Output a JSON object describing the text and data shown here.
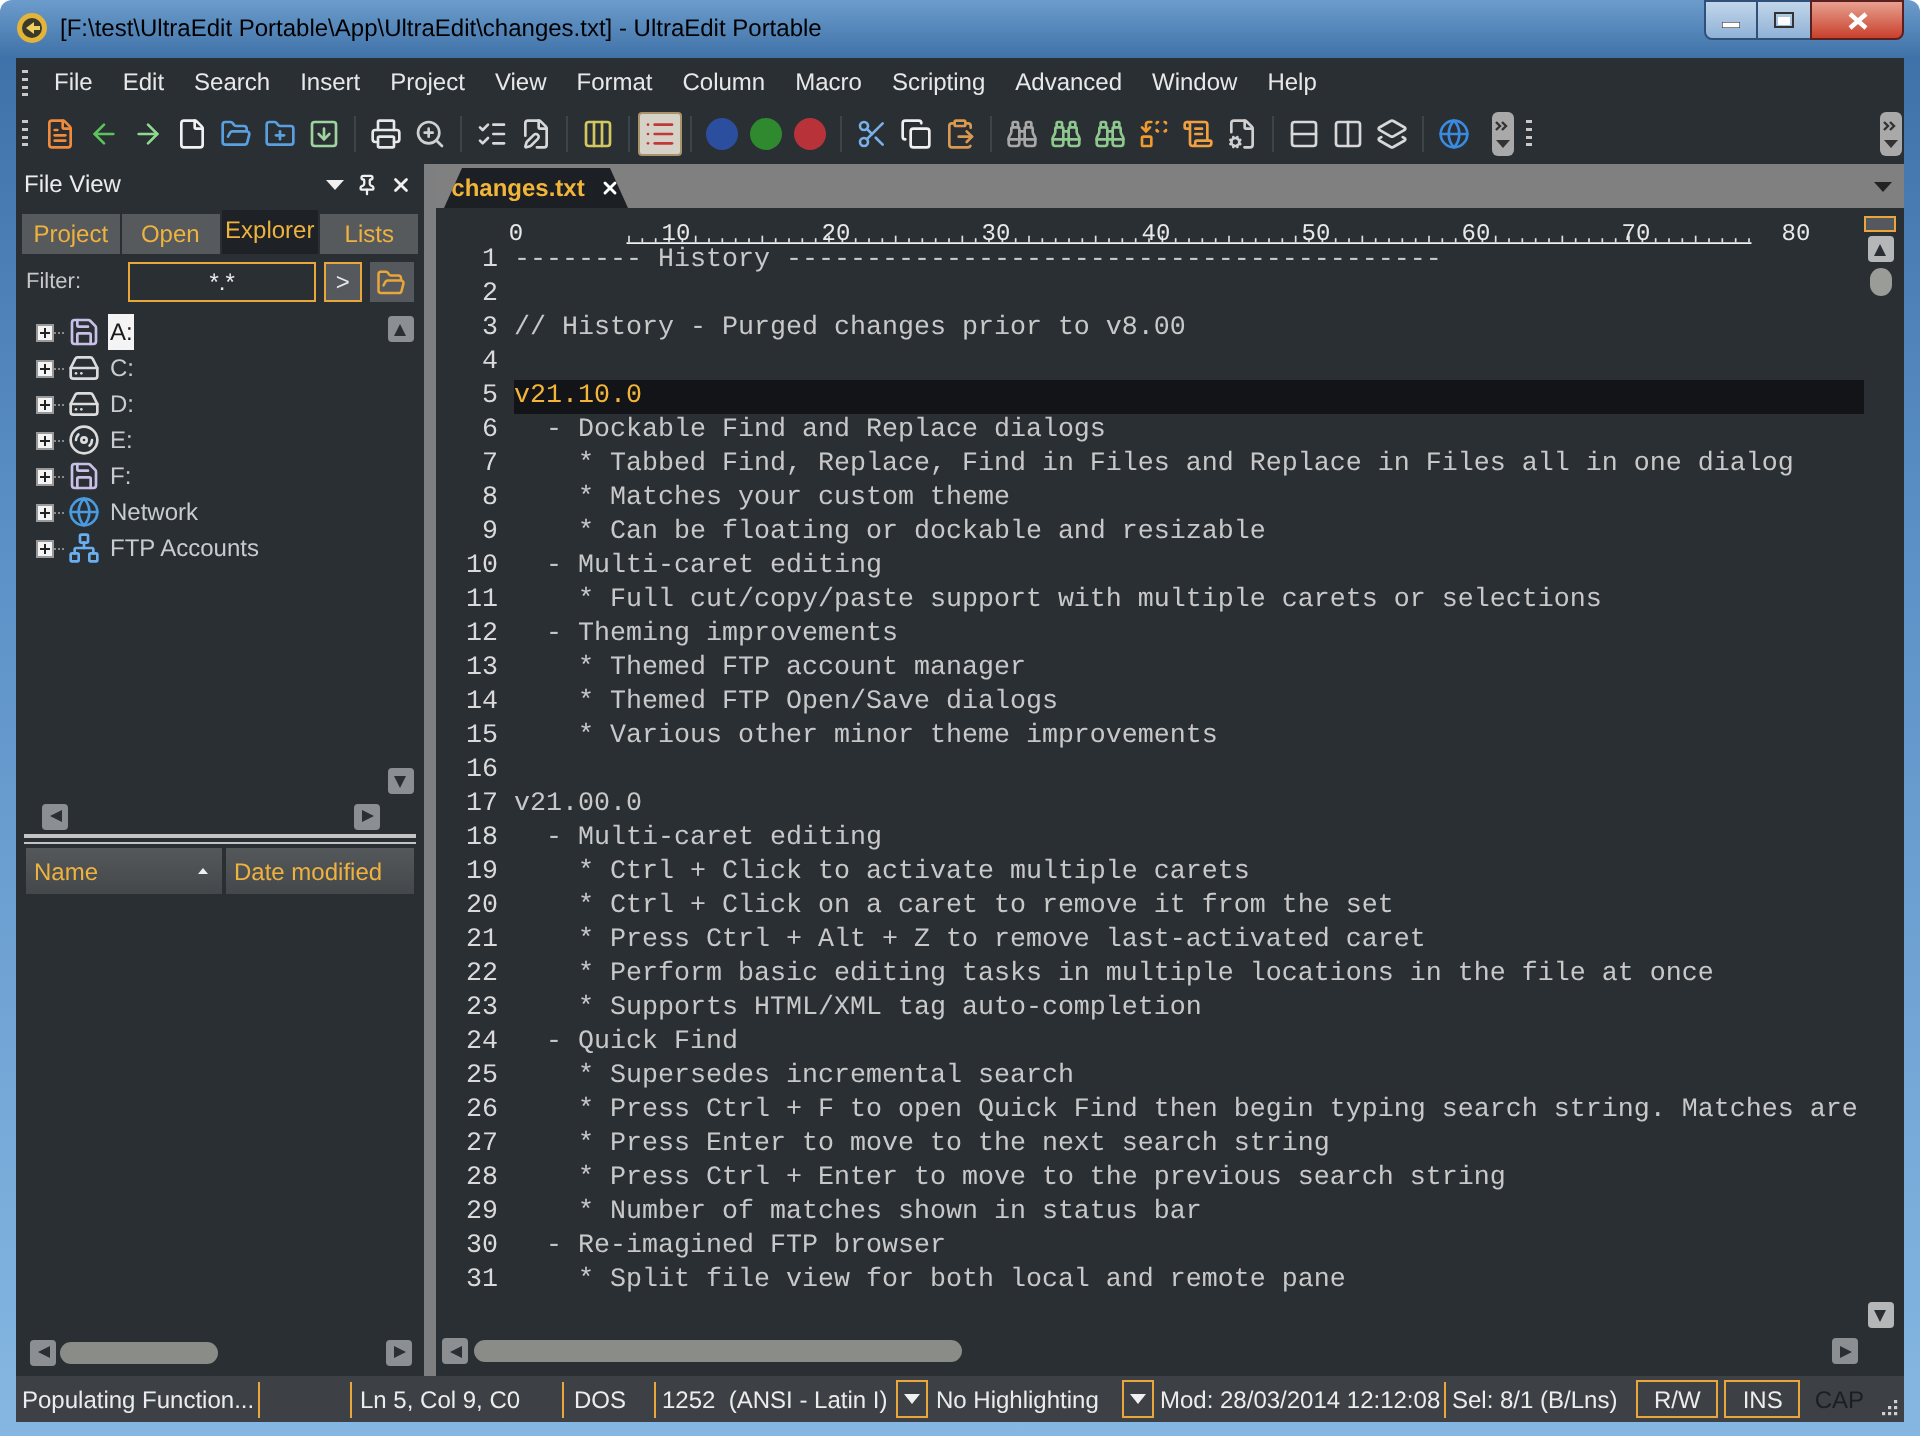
{
  "window": {
    "title": "[F:\\test\\UltraEdit Portable\\App\\UltraEdit\\changes.txt] - UltraEdit Portable"
  },
  "menu": [
    "File",
    "Edit",
    "Search",
    "Insert",
    "Project",
    "View",
    "Format",
    "Column",
    "Macro",
    "Scripting",
    "Advanced",
    "Window",
    "Help"
  ],
  "toolbar": {
    "buttons": [
      {
        "kind": "template",
        "pressed": false
      },
      {
        "kind": "back",
        "pressed": false
      },
      {
        "kind": "forward",
        "pressed": false
      },
      {
        "kind": "new",
        "pressed": false
      },
      {
        "kind": "open",
        "pressed": false
      },
      {
        "kind": "newfolder",
        "pressed": false
      },
      {
        "kind": "save",
        "pressed": false
      },
      {
        "kind": "separator"
      },
      {
        "kind": "print",
        "pressed": false
      },
      {
        "kind": "preview",
        "pressed": false
      },
      {
        "kind": "separator"
      },
      {
        "kind": "checklist",
        "pressed": false
      },
      {
        "kind": "edit",
        "pressed": false
      },
      {
        "kind": "separator"
      },
      {
        "kind": "columns",
        "pressed": false
      },
      {
        "kind": "separator"
      },
      {
        "kind": "list",
        "pressed": true
      },
      {
        "kind": "separator"
      },
      {
        "kind": "badge",
        "color": "#2b4f9e",
        "pressed": false
      },
      {
        "kind": "badge",
        "color": "#2f8a2f",
        "pressed": false
      },
      {
        "kind": "badge",
        "color": "#b8323a",
        "pressed": false
      },
      {
        "kind": "separator"
      },
      {
        "kind": "cut",
        "pressed": false
      },
      {
        "kind": "copy",
        "pressed": false
      },
      {
        "kind": "paste",
        "pressed": false
      },
      {
        "kind": "separator"
      },
      {
        "kind": "find",
        "pressed": false
      },
      {
        "kind": "findprev",
        "pressed": false
      },
      {
        "kind": "findnext",
        "pressed": false
      },
      {
        "kind": "replace",
        "pressed": false
      },
      {
        "kind": "lines",
        "pressed": false
      },
      {
        "kind": "docgear",
        "pressed": false
      },
      {
        "kind": "separator"
      },
      {
        "kind": "tileh",
        "pressed": false
      },
      {
        "kind": "tilev",
        "pressed": false
      },
      {
        "kind": "cascade",
        "pressed": false
      },
      {
        "kind": "separator"
      },
      {
        "kind": "web",
        "pressed": false
      }
    ]
  },
  "file_view": {
    "title": "File View",
    "tabs": [
      {
        "label": "Project",
        "selected": false
      },
      {
        "label": "Open",
        "selected": false
      },
      {
        "label": "Explorer",
        "selected": true
      },
      {
        "label": "Lists",
        "selected": false
      }
    ],
    "filter": {
      "label": "Filter:",
      "value": "*.*",
      "go": ">"
    },
    "tree": [
      {
        "label": "A:",
        "kind": "floppy",
        "selected": true,
        "expanded": false
      },
      {
        "label": "C:",
        "kind": "disk",
        "selected": false,
        "expanded": false
      },
      {
        "label": "D:",
        "kind": "disk",
        "selected": false,
        "expanded": false
      },
      {
        "label": "E:",
        "kind": "mapped",
        "selected": false,
        "expanded": false
      },
      {
        "label": "F:",
        "kind": "floppy",
        "selected": false,
        "expanded": false
      },
      {
        "label": "Network",
        "kind": "network",
        "selected": false,
        "expanded": false
      },
      {
        "label": "FTP Accounts",
        "kind": "ftp",
        "selected": false,
        "expanded": false
      }
    ],
    "list": {
      "columns": [
        {
          "label": "Name",
          "sorted": true
        },
        {
          "label": "Date modified",
          "sorted": false
        }
      ]
    }
  },
  "editor": {
    "tabs": [
      {
        "label": "changes.txt",
        "selected": true
      }
    ],
    "ruler": [
      "0",
      "10",
      "20",
      "30",
      "40",
      "50",
      "60",
      "70",
      "80"
    ],
    "lines": [
      {
        "number": "1",
        "text": "-------- History -----------------------------------------",
        "selected": false
      },
      {
        "number": "2",
        "selected": false
      },
      {
        "number": "3",
        "text": "// History - Purged changes prior to v8.00",
        "selected": false
      },
      {
        "number": "4",
        "selected": false
      },
      {
        "number": "5",
        "text": "v21.10.0",
        "selected": true
      },
      {
        "number": "6",
        "text": "  - Dockable Find and Replace dialogs",
        "selected": false
      },
      {
        "number": "7",
        "text": "    * Tabbed Find, Replace, Find in Files and Replace in Files all in one dialog",
        "selected": false
      },
      {
        "number": "8",
        "text": "    * Matches your custom theme",
        "selected": false
      },
      {
        "number": "9",
        "text": "    * Can be floating or dockable and resizable",
        "selected": false
      },
      {
        "number": "10",
        "text": "  - Multi-caret editing",
        "selected": false
      },
      {
        "number": "11",
        "text": "    * Full cut/copy/paste support with multiple carets or selections",
        "selected": false
      },
      {
        "number": "12",
        "text": "  - Theming improvements",
        "selected": false
      },
      {
        "number": "13",
        "text": "    * Themed FTP account manager",
        "selected": false
      },
      {
        "number": "14",
        "text": "    * Themed FTP Open/Save dialogs",
        "selected": false
      },
      {
        "number": "15",
        "text": "    * Various other minor theme improvements",
        "selected": false
      },
      {
        "number": "16",
        "selected": false
      },
      {
        "number": "17",
        "text": "v21.00.0",
        "selected": false
      },
      {
        "number": "18",
        "text": "  - Multi-caret editing",
        "selected": false
      },
      {
        "number": "19",
        "text": "    * Ctrl + Click to activate multiple carets",
        "selected": false
      },
      {
        "number": "20",
        "text": "    * Ctrl + Click on a caret to remove it from the set",
        "selected": false
      },
      {
        "number": "21",
        "text": "    * Press Ctrl + Alt + Z to remove last-activated caret",
        "selected": false
      },
      {
        "number": "22",
        "text": "    * Perform basic editing tasks in multiple locations in the file at once",
        "selected": false
      },
      {
        "number": "23",
        "text": "    * Supports HTML/XML tag auto-completion",
        "selected": false
      },
      {
        "number": "24",
        "text": "  - Quick Find",
        "selected": false
      },
      {
        "number": "25",
        "text": "    * Supersedes incremental search",
        "selected": false
      },
      {
        "number": "26",
        "text": "    * Press Ctrl + F to open Quick Find then begin typing search string. Matches are",
        "selected": false
      },
      {
        "number": "27",
        "text": "    * Press Enter to move to the next search string",
        "selected": false
      },
      {
        "number": "28",
        "text": "    * Press Ctrl + Enter to move to the previous search string",
        "selected": false
      },
      {
        "number": "29",
        "text": "    * Number of matches shown in status bar",
        "selected": false
      },
      {
        "number": "30",
        "text": "  - Re-imagined FTP browser",
        "selected": false
      },
      {
        "number": "31",
        "text": "    * Split file view for both local and remote pane",
        "selected": false
      }
    ]
  },
  "status_bar": {
    "message": "Populating Function...",
    "position": "Ln 5, Col 9, C0",
    "line_ending": "DOS",
    "encoding": "1252  (ANSI - Latin I)",
    "highlighting": "No Highlighting",
    "modified": "Mod: 28/03/2014 12:12:08",
    "selection": "Sel: 8/1 (B/Lns)",
    "indicators": [
      {
        "label": "R/W",
        "on": true
      },
      {
        "label": "INS",
        "on": true
      },
      {
        "label": "CAP",
        "on": false
      }
    ]
  }
}
